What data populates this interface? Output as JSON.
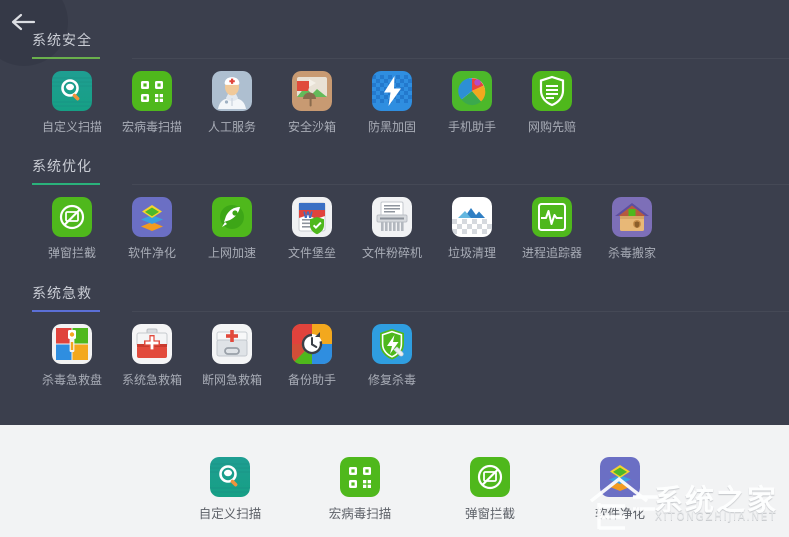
{
  "window": {
    "back_button_label": "返回",
    "back_icon": "arrow-left-icon",
    "background_dark": "#3b3f4d",
    "background_light": "#f2f3f4"
  },
  "sections": [
    {
      "title": "系统安全",
      "rule_color": "#6ab04c",
      "items": [
        {
          "label": "自定义扫描",
          "icon": "custom-scan-icon"
        },
        {
          "label": "宏病毒扫描",
          "icon": "macro-virus-scan-icon"
        },
        {
          "label": "人工服务",
          "icon": "manual-service-icon"
        },
        {
          "label": "安全沙箱",
          "icon": "sandbox-icon"
        },
        {
          "label": "防黑加固",
          "icon": "anti-hack-icon"
        },
        {
          "label": "手机助手",
          "icon": "mobile-assistant-icon"
        },
        {
          "label": "网购先赔",
          "icon": "shopping-protection-icon"
        }
      ]
    },
    {
      "title": "系统优化",
      "rule_color": "#2ab27b",
      "items": [
        {
          "label": "弹窗拦截",
          "icon": "popup-blocker-icon"
        },
        {
          "label": "软件净化",
          "icon": "software-cleanup-icon"
        },
        {
          "label": "上网加速",
          "icon": "network-booster-icon"
        },
        {
          "label": "文件堡垒",
          "icon": "file-vault-icon"
        },
        {
          "label": "文件粉碎机",
          "icon": "file-shredder-icon"
        },
        {
          "label": "垃圾清理",
          "icon": "junk-cleaner-icon"
        },
        {
          "label": "进程追踪器",
          "icon": "process-tracker-icon"
        },
        {
          "label": "杀毒搬家",
          "icon": "antivirus-relocate-icon"
        }
      ]
    },
    {
      "title": "系统急救",
      "rule_color": "#5b6fd6",
      "items": [
        {
          "label": "杀毒急救盘",
          "icon": "rescue-disk-icon"
        },
        {
          "label": "系统急救箱",
          "icon": "system-first-aid-icon"
        },
        {
          "label": "断网急救箱",
          "icon": "network-first-aid-icon"
        },
        {
          "label": "备份助手",
          "icon": "backup-assistant-icon"
        },
        {
          "label": "修复杀毒",
          "icon": "repair-antivirus-icon"
        }
      ]
    }
  ],
  "bottom_bar": {
    "items": [
      {
        "label": "自定义扫描",
        "icon": "custom-scan-icon"
      },
      {
        "label": "宏病毒扫描",
        "icon": "macro-virus-scan-icon"
      },
      {
        "label": "弹窗拦截",
        "icon": "popup-blocker-icon"
      },
      {
        "label": "软件净化",
        "icon": "software-cleanup-icon"
      }
    ]
  },
  "watermark": {
    "text": "系统之家",
    "sub": "XITONGZHIJIA.NET"
  }
}
